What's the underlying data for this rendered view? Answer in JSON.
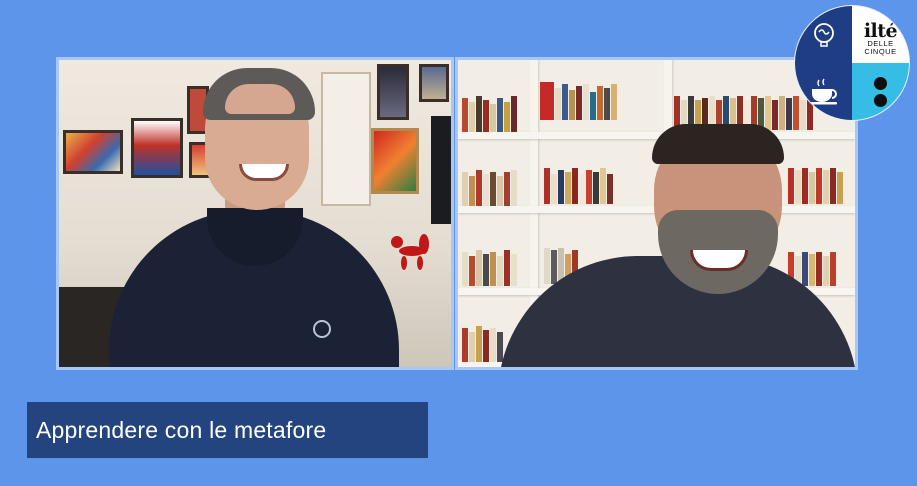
{
  "app": {
    "background_color": "#5d95ea",
    "caption_color": "#24447f"
  },
  "participants": [
    {
      "tile": "left",
      "description_icon": "speaker-video"
    },
    {
      "tile": "right",
      "description_icon": "speaker-video"
    }
  ],
  "logo": {
    "title": "ilté",
    "subtitle_line1": "DELLE",
    "subtitle_line2": "CINQUE",
    "icons": [
      "lightbulb-brain-icon",
      "teacup-icon",
      "colon-dots-icon"
    ]
  },
  "caption": {
    "text": "Apprendere con le metafore"
  }
}
